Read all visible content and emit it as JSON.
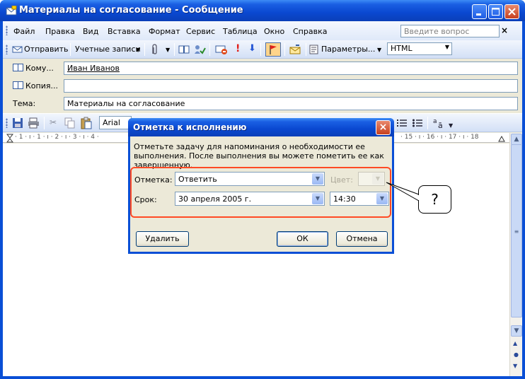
{
  "window": {
    "title": "Материалы на согласование - Сообщение"
  },
  "menu": {
    "items": [
      "Файл",
      "Правка",
      "Вид",
      "Вставка",
      "Формат",
      "Сервис",
      "Таблица",
      "Окно",
      "Справка"
    ],
    "ask_placeholder": "Введите вопрос"
  },
  "toolbar": {
    "send": "Отправить",
    "accounts": "Учетные записи",
    "options": "Параметры...",
    "format": "HTML"
  },
  "header": {
    "to_label": "Кому...",
    "to_value": "Иван Иванов",
    "cc_label": "Копия...",
    "cc_value": "",
    "subject_label": "Тема:",
    "subject_value": "Материалы на согласование"
  },
  "formatting": {
    "font": "Arial"
  },
  "ruler": {
    "left_text": "· 1 · ı · 1 · ı · 2 · ı · 3 · ı · 4 ·",
    "right_text": "· 15 · ı · 16 · ı · 17 · ı · 18"
  },
  "dialog": {
    "title": "Отметка к исполнению",
    "description": "Отметьте задачу для напоминания о необходимости ее выполнения. После выполнения вы можете пометить ее как завершенную.",
    "flag_label": "Отметка:",
    "flag_value": "Ответить",
    "color_label": "Цвет:",
    "color_value": "",
    "due_label": "Срок:",
    "due_date": "30 апреля 2005 г.",
    "due_time": "14:30",
    "delete_button": "Удалить",
    "ok_button": "ОК",
    "cancel_button": "Отмена"
  },
  "callout": {
    "text": "?"
  },
  "colors": {
    "title_blue": "#0a4fd6",
    "highlight_red": "#ff4a24",
    "face": "#ece9d8"
  }
}
